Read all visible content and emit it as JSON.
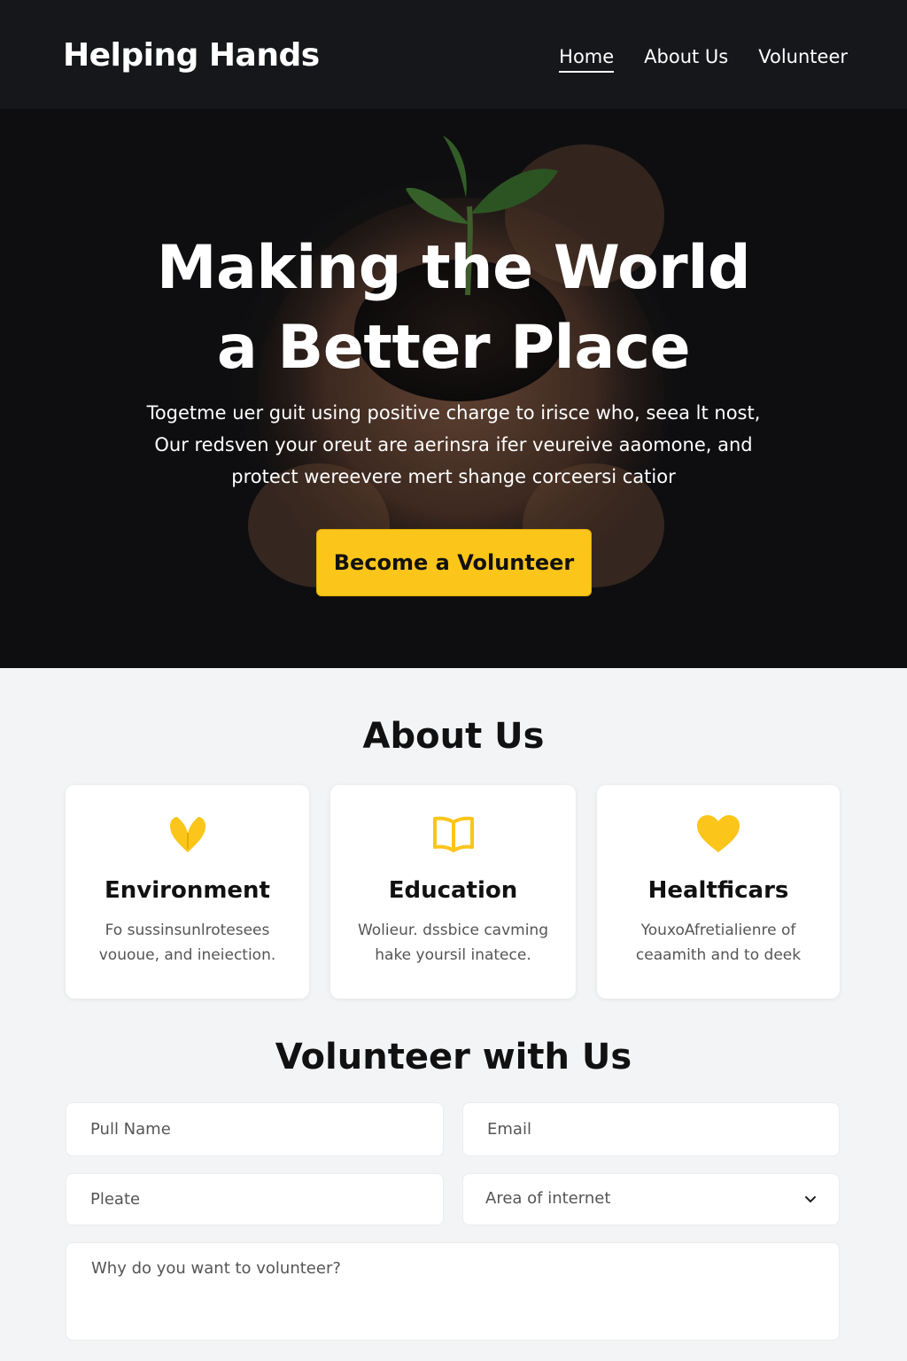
{
  "header": {
    "brand": "Helping Hands",
    "nav": [
      {
        "label": "Home",
        "active": true
      },
      {
        "label": "About Us",
        "active": false
      },
      {
        "label": "Volunteer",
        "active": false
      }
    ]
  },
  "hero": {
    "title_lines": [
      "Making the World",
      "a Better Place"
    ],
    "text_lines": [
      "Togetme uer guit using positive charge to irisce who, seea lt nost,",
      "Our redsven your oreut are aerinsra ifer veureive aaomone, and",
      "protect wereevere mert shange corceersi catior"
    ],
    "cta_label": "Become a Volunteer"
  },
  "about": {
    "title": "About Us",
    "cards": [
      {
        "icon": "leaf-heart-icon",
        "title": "Environment",
        "desc_lines": [
          "Fo sussinsunlrotesees",
          "vououe, and ineiection."
        ]
      },
      {
        "icon": "open-book-icon",
        "title": "Education",
        "desc_lines": [
          "Wolieur. dssbice cavming",
          "hake yoursil inatece."
        ]
      },
      {
        "icon": "heart-icon",
        "title": "Healtficars",
        "desc_lines": [
          "YouxoAfretialienre of",
          "ceaamith and to deek"
        ]
      }
    ]
  },
  "volunteer": {
    "title": "Volunteer with Us",
    "name_placeholder": "Pull Name",
    "email_placeholder": "Email",
    "phone_placeholder": "Pleate",
    "area_label": "Area of internet",
    "reason_placeholder": "Why do you want to volunteer?"
  },
  "colors": {
    "accent": "#fbc51a",
    "dark": "#15171a",
    "background": "#f3f4f6"
  }
}
